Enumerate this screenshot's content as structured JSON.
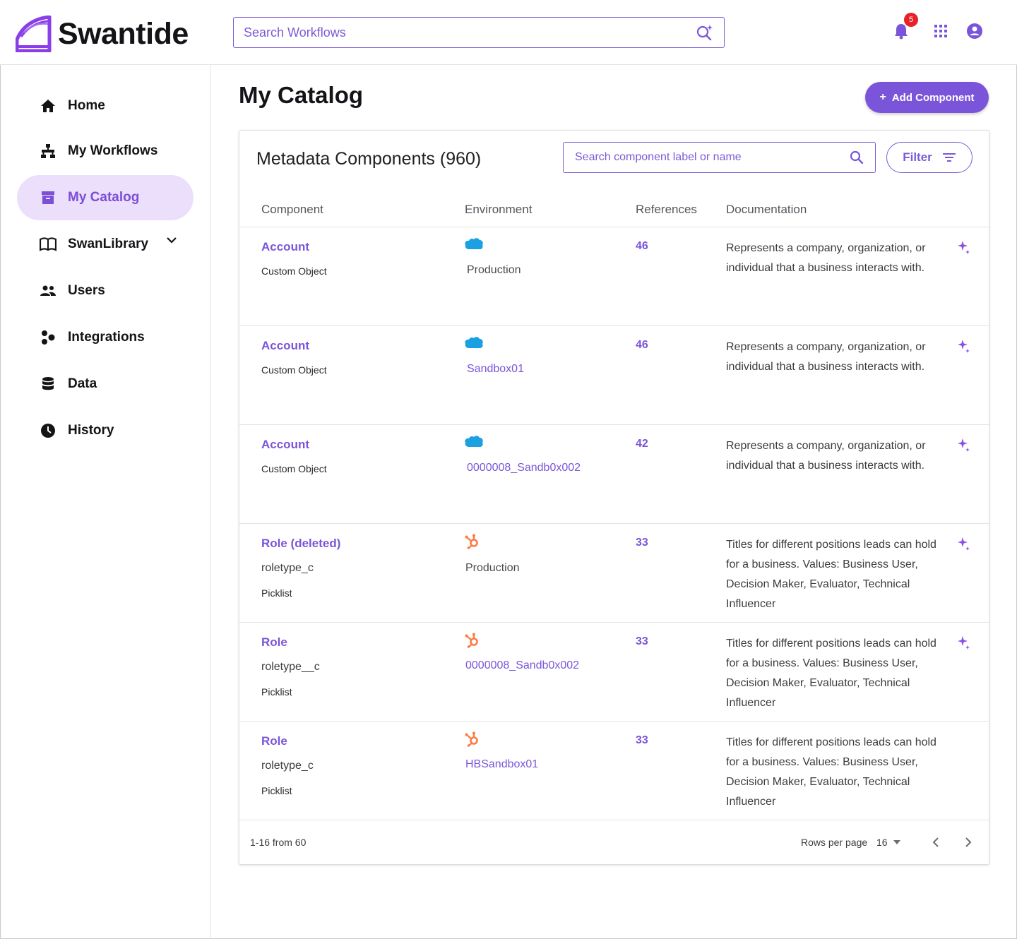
{
  "app": {
    "name": "Swantide",
    "brand_color": "#7b55d9"
  },
  "header": {
    "search_placeholder": "Search Workflows",
    "notifications_count": "5"
  },
  "sidebar": {
    "items": [
      {
        "label": "Home",
        "icon": "home-icon"
      },
      {
        "label": "My Workflows",
        "icon": "workflow-icon"
      },
      {
        "label": "My Catalog",
        "icon": "catalog-icon",
        "active": true
      },
      {
        "label": "SwanLibrary",
        "icon": "book-icon",
        "expandable": true
      },
      {
        "label": "Users",
        "icon": "users-icon"
      },
      {
        "label": "Integrations",
        "icon": "integrations-icon"
      },
      {
        "label": "Data",
        "icon": "database-icon"
      },
      {
        "label": "History",
        "icon": "clock-icon"
      }
    ]
  },
  "main": {
    "title": "My Catalog",
    "add_button": "Add Component",
    "card_title": "Metadata Components (960)",
    "search_placeholder": "Search component label or name",
    "filter_label": "Filter",
    "columns": [
      "Component",
      "Environment",
      "References",
      "Documentation"
    ],
    "rows": [
      {
        "name": "Account",
        "api": "",
        "type": "Custom Object",
        "env_icon": "salesforce-cloud-icon",
        "env": "Production",
        "env_link": false,
        "refs": "46",
        "doc": "Represents a company, organization, or individual that a business interacts with.",
        "sparkle": true
      },
      {
        "name": "Account",
        "api": "",
        "type": "Custom Object",
        "env_icon": "salesforce-cloud-icon",
        "env": "Sandbox01",
        "env_link": true,
        "refs": "46",
        "doc": "Represents a company, organization, or individual that a business interacts with.",
        "sparkle": true
      },
      {
        "name": "Account",
        "api": "",
        "type": "Custom Object",
        "env_icon": "salesforce-cloud-icon",
        "env": "0000008_Sandb0x002",
        "env_link": true,
        "refs": "42",
        "doc": "Represents a company, organization, or individual that a business interacts with.",
        "sparkle": true
      },
      {
        "name": "Role  (deleted)",
        "api": "roletype_c",
        "type": "Picklist",
        "env_icon": "hubspot-icon",
        "env": "Production",
        "env_link": false,
        "refs": "33",
        "doc": "Titles for different positions leads can hold for a business. Values: Business User, Decision Maker, Evaluator, Technical Influencer",
        "sparkle": true
      },
      {
        "name": "Role",
        "api": "roletype__c",
        "type": "Picklist",
        "env_icon": "hubspot-icon",
        "env": "0000008_Sandb0x002",
        "env_link": true,
        "refs": "33",
        "doc": "Titles for different positions leads can hold for a business. Values: Business User, Decision Maker, Evaluator, Technical Influencer",
        "sparkle": true
      },
      {
        "name": "Role",
        "api": "roletype_c",
        "type": "Picklist",
        "env_icon": "hubspot-icon",
        "env": "HBSandbox01",
        "env_link": true,
        "refs": "33",
        "doc": "Titles for different positions leads can hold for a business. Values: Business User, Decision Maker, Evaluator, Technical Influencer",
        "sparkle": false
      }
    ],
    "pagination": {
      "range": "1-16 from 60",
      "rows_per_page_label": "Rows per page",
      "rows_per_page_value": "16"
    }
  }
}
